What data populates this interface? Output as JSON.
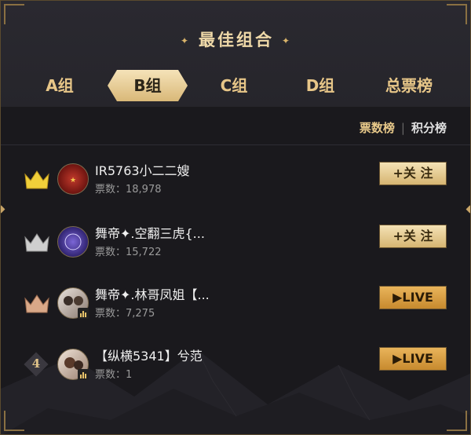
{
  "header": {
    "title": "最佳组合"
  },
  "tabs": [
    {
      "label": "A组",
      "active": false
    },
    {
      "label": "B组",
      "active": true
    },
    {
      "label": "C组",
      "active": false
    },
    {
      "label": "D组",
      "active": false
    },
    {
      "label": "总票榜",
      "active": false
    }
  ],
  "sort": {
    "votes_label": "票数榜",
    "points_label": "积分榜",
    "separator": "|"
  },
  "rows": [
    {
      "rank_icon": "crown-gold-icon",
      "name": "IR5763小二二嫂",
      "votes": "票数：18,978",
      "action": "+关 注",
      "action_type": "follow"
    },
    {
      "rank_icon": "crown-silver-icon",
      "name": "舞帝✦.空翻三虎{...",
      "votes": "票数：15,722",
      "action": "+关 注",
      "action_type": "follow"
    },
    {
      "rank_icon": "crown-bronze-icon",
      "name": "舞帝✦.林哥凤姐【...",
      "votes": "票数：7,275",
      "action": "▶LIVE",
      "action_type": "live"
    },
    {
      "rank_icon": "rank-badge-icon",
      "rank_number": "4",
      "name": "【纵横5341】兮范",
      "votes": "票数：1",
      "action": "▶LIVE",
      "action_type": "live"
    }
  ],
  "colors": {
    "accent": "#e8c98a",
    "tab_active_bg": "#f5e3b9",
    "panel_bg": "#1a191d"
  }
}
